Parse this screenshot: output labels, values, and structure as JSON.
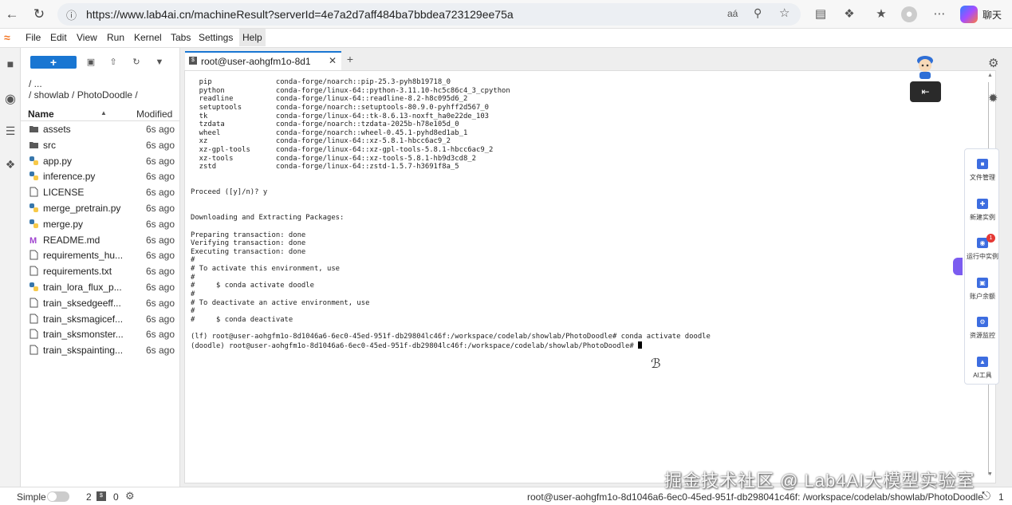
{
  "browser": {
    "url": "https://www.lab4ai.cn/machineResult?serverId=4e7a2d7aff484ba7bbdea723129ee75a",
    "chat_label": "聊天"
  },
  "menu": {
    "items": [
      "File",
      "Edit",
      "View",
      "Run",
      "Kernel",
      "Tabs",
      "Settings",
      "Help"
    ]
  },
  "file_browser": {
    "new_label": "+",
    "breadcrumb_root": "/ ...",
    "breadcrumb_path": "/ showlab / PhotoDoodle /",
    "col_name": "Name",
    "col_modified": "Modified",
    "files": [
      {
        "name": "assets",
        "icon": "folder-icon",
        "modified": "6s ago"
      },
      {
        "name": "src",
        "icon": "folder-icon",
        "modified": "6s ago"
      },
      {
        "name": "app.py",
        "icon": "python-icon",
        "modified": "6s ago"
      },
      {
        "name": "inference.py",
        "icon": "python-icon",
        "modified": "6s ago"
      },
      {
        "name": "LICENSE",
        "icon": "file-icon",
        "modified": "6s ago"
      },
      {
        "name": "merge_pretrain.py",
        "icon": "python-icon",
        "modified": "6s ago"
      },
      {
        "name": "merge.py",
        "icon": "python-icon",
        "modified": "6s ago"
      },
      {
        "name": "README.md",
        "icon": "markdown-icon",
        "modified": "6s ago"
      },
      {
        "name": "requirements_hu...",
        "icon": "file-icon",
        "modified": "6s ago"
      },
      {
        "name": "requirements.txt",
        "icon": "file-icon",
        "modified": "6s ago"
      },
      {
        "name": "train_lora_flux_p...",
        "icon": "python-icon",
        "modified": "6s ago"
      },
      {
        "name": "train_sksedgeeff...",
        "icon": "file-icon",
        "modified": "6s ago"
      },
      {
        "name": "train_sksmagicef...",
        "icon": "file-icon",
        "modified": "6s ago"
      },
      {
        "name": "train_sksmonster...",
        "icon": "file-icon",
        "modified": "6s ago"
      },
      {
        "name": "train_skspainting...",
        "icon": "file-icon",
        "modified": "6s ago"
      }
    ]
  },
  "terminal": {
    "tab_label": "root@user-aohgfm1o-8d1",
    "lines": [
      "  pip               conda-forge/noarch::pip-25.3-pyh8b19718_0",
      "  python            conda-forge/linux-64::python-3.11.10-hc5c86c4_3_cpython",
      "  readline          conda-forge/linux-64::readline-8.2-h8c095d6_2",
      "  setuptools        conda-forge/noarch::setuptools-80.9.0-pyhff2d567_0",
      "  tk                conda-forge/linux-64::tk-8.6.13-noxft_ha0e22de_103",
      "  tzdata            conda-forge/noarch::tzdata-2025b-h78e105d_0",
      "  wheel             conda-forge/noarch::wheel-0.45.1-pyhd8ed1ab_1",
      "  xz                conda-forge/linux-64::xz-5.8.1-hbcc6ac9_2",
      "  xz-gpl-tools      conda-forge/linux-64::xz-gpl-tools-5.8.1-hbcc6ac9_2",
      "  xz-tools          conda-forge/linux-64::xz-tools-5.8.1-hb9d3cd8_2",
      "  zstd              conda-forge/linux-64::zstd-1.5.7-h3691f8a_5",
      "",
      "",
      "Proceed ([y]/n)? y",
      "",
      "",
      "Downloading and Extracting Packages:",
      "",
      "Preparing transaction: done",
      "Verifying transaction: done",
      "Executing transaction: done",
      "#",
      "# To activate this environment, use",
      "#",
      "#     $ conda activate doodle",
      "#",
      "# To deactivate an active environment, use",
      "#",
      "#     $ conda deactivate",
      "",
      "(lf) root@user-aohgfm1o-8d1046a6-6ec0-45ed-951f-db29804lc46f:/workspace/codelab/showlab/PhotoDoodle# conda activate doodle"
    ],
    "prompt_line": "(doodle) root@user-aohgfm1o-8d1046a6-6ec0-45ed-951f-db29804lc46f:/workspace/codelab/showlab/PhotoDoodle# "
  },
  "side_panel": {
    "items": [
      {
        "label": "文件管理",
        "icon": "folder-manage-icon",
        "badge": ""
      },
      {
        "label": "新建实例",
        "icon": "new-instance-icon",
        "badge": ""
      },
      {
        "label": "运行中实例",
        "icon": "running-instance-icon",
        "badge": "1"
      },
      {
        "label": "账户余额",
        "icon": "wallet-icon",
        "badge": ""
      },
      {
        "label": "资源监控",
        "icon": "monitor-icon",
        "badge": ""
      },
      {
        "label": "AI工具",
        "icon": "ai-tools-icon",
        "badge": ""
      }
    ]
  },
  "status": {
    "mode_label": "Simple",
    "terminals_count": "2",
    "kernels_count": "0",
    "path": "root@user-aohgfm1o-8d1046a6-6ec0-45ed-951f-db298041c46f: /workspace/codelab/showlab/PhotoDoodle",
    "notification_count": "1"
  },
  "watermark": "掘金技术社区 @ Lab4AI大模型实验室",
  "colors": {
    "accent": "#1976d2",
    "side_accent": "#3d6de0"
  }
}
